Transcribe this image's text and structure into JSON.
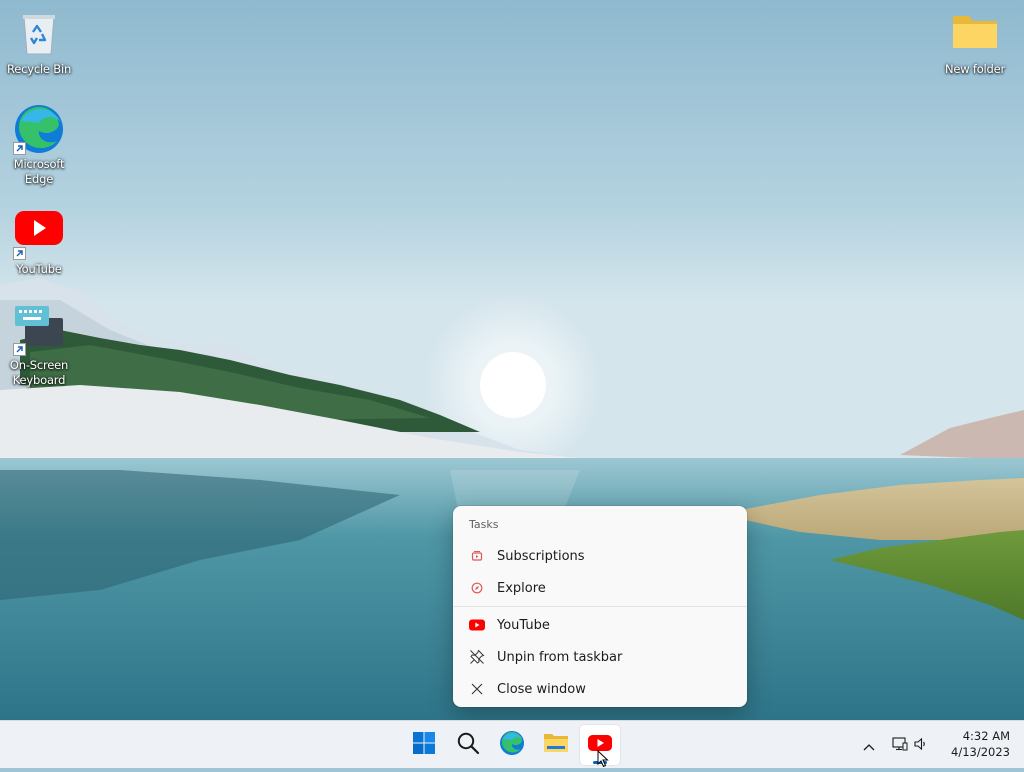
{
  "desktop": {
    "icons": [
      {
        "label": "Recycle Bin",
        "icon": "recycle-bin-icon"
      },
      {
        "label": "Microsoft Edge",
        "icon": "edge-icon",
        "shortcut": true
      },
      {
        "label": "YouTube",
        "icon": "youtube-icon",
        "shortcut": true
      },
      {
        "label": "On-Screen Keyboard",
        "icon": "keyboard-icon",
        "shortcut": true
      },
      {
        "label": "New folder",
        "icon": "folder-icon"
      }
    ]
  },
  "jumplist": {
    "section_title": "Tasks",
    "tasks": [
      {
        "label": "Subscriptions",
        "icon": "subscriptions-icon"
      },
      {
        "label": "Explore",
        "icon": "compass-icon"
      }
    ],
    "actions": [
      {
        "label": "YouTube",
        "icon": "youtube-icon"
      },
      {
        "label": "Unpin from taskbar",
        "icon": "unpin-icon"
      },
      {
        "label": "Close window",
        "icon": "close-icon"
      }
    ]
  },
  "taskbar": {
    "apps": [
      {
        "name": "Start",
        "icon": "windows-start-icon"
      },
      {
        "name": "Search",
        "icon": "search-icon"
      },
      {
        "name": "Microsoft Edge",
        "icon": "edge-icon"
      },
      {
        "name": "File Explorer",
        "icon": "folder-icon"
      },
      {
        "name": "YouTube",
        "icon": "youtube-icon",
        "active": true
      }
    ],
    "tray": {
      "time": "4:32 AM",
      "date": "4/13/2023"
    }
  },
  "colors": {
    "youtube_red": "#ff0000",
    "accent": "#0067c0",
    "taskbar_bg": "#eef1f5",
    "menu_bg": "#f9f9f9"
  }
}
